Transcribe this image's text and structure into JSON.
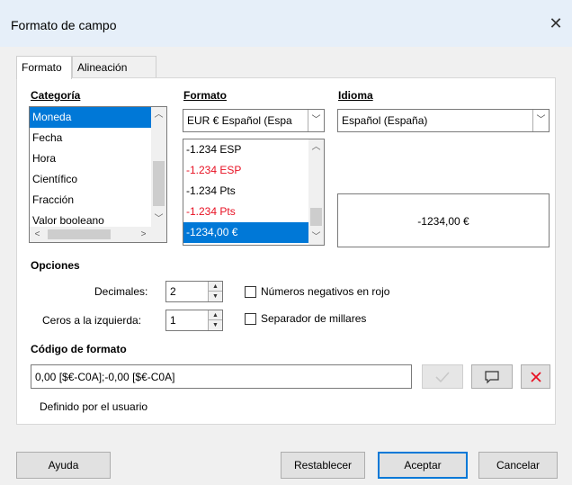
{
  "window": {
    "title": "Formato de campo",
    "close_glyph": "✕"
  },
  "tabs": [
    {
      "label": "Formato",
      "active": true
    },
    {
      "label": "Alineación",
      "active": false
    }
  ],
  "categoria": {
    "label": "Categoría",
    "items": [
      "Moneda",
      "Fecha",
      "Hora",
      "Científico",
      "Fracción",
      "Valor booleano"
    ],
    "selected": "Moneda"
  },
  "formato": {
    "label": "Formato",
    "combo_value": "EUR € Español (Espa",
    "items": [
      {
        "text": "-1.234 ESP",
        "negative": false
      },
      {
        "text": "-1.234 ESP",
        "negative": true
      },
      {
        "text": "-1.234 Pts",
        "negative": false
      },
      {
        "text": "-1.234 Pts",
        "negative": true
      },
      {
        "text": "-1234,00 €",
        "negative": false
      }
    ],
    "selected_index": 4
  },
  "idioma": {
    "label": "Idioma",
    "value": "Español (España)"
  },
  "preview": {
    "text": "-1234,00 €"
  },
  "opciones": {
    "label": "Opciones",
    "decimales_label": "Decimales:",
    "decimales_value": "2",
    "ceros_label": "Ceros a la izquierda:",
    "ceros_value": "1",
    "negativos_label": "Números negativos en rojo",
    "negativos_checked": false,
    "separador_label": "Separador de millares",
    "separador_checked": false
  },
  "codigo": {
    "label": "Código de formato",
    "value": "0,00 [$€-C0A];-0,00 [$€-C0A]",
    "status": "Definido por el usuario"
  },
  "buttons": {
    "help": "Ayuda",
    "reset": "Restablecer",
    "ok": "Aceptar",
    "cancel": "Cancelar"
  },
  "colors": {
    "accent": "#0078d7",
    "negative": "#e81123",
    "delete": "#e81123"
  }
}
